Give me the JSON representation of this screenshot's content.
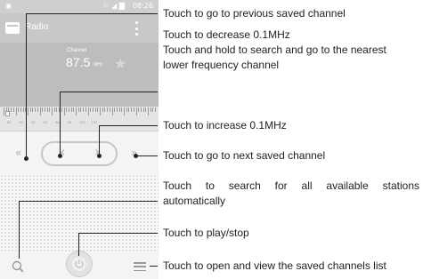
{
  "status_bar": {
    "time": "08:26",
    "icons": "⚐ ◢ ▇"
  },
  "app_bar": {
    "title": "Radio"
  },
  "display": {
    "channel_label": "Channel",
    "frequency": "87.5",
    "unit": "MHz"
  },
  "dial": {
    "labels": [
      "88",
      "90",
      "92",
      "94",
      "96",
      "98",
      "100",
      "102"
    ]
  },
  "controls": {
    "prev_saved": "«",
    "decrease": "‹",
    "increase": "›",
    "next_saved": "»"
  },
  "callouts": {
    "prev_saved": "Touch to go to previous saved channel",
    "decrease_1": "Touch to decrease 0.1MHz",
    "decrease_2": "Touch and hold to search and go to the nearest",
    "decrease_3": "lower frequency channel",
    "increase": "Touch to increase 0.1MHz",
    "next_saved": "Touch to go to next saved channel",
    "search_1": "Touch to search for all available stations",
    "search_2": "automatically",
    "play_stop": "Touch to play/stop",
    "saved_list": "Touch to open and view the saved channels list"
  }
}
